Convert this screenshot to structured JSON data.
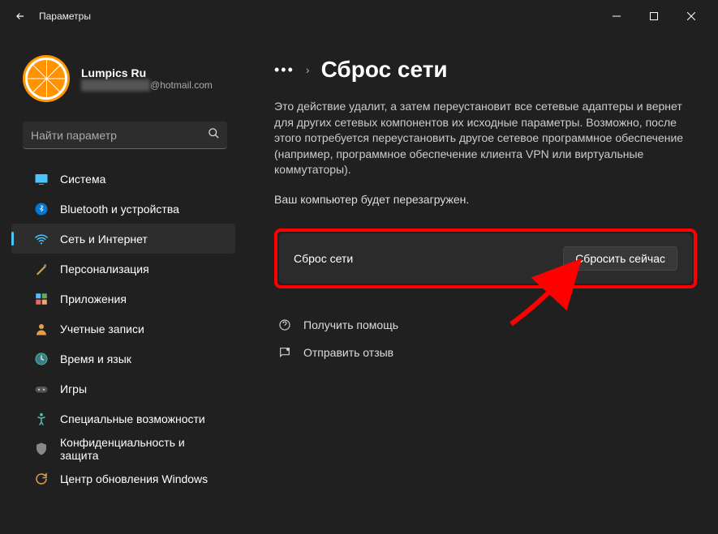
{
  "window": {
    "title": "Параметры"
  },
  "profile": {
    "name": "Lumpics Ru",
    "email_suffix": "@hotmail.com"
  },
  "search": {
    "placeholder": "Найти параметр"
  },
  "sidebar": {
    "items": [
      {
        "label": "Система",
        "icon": "system"
      },
      {
        "label": "Bluetooth и устройства",
        "icon": "bluetooth"
      },
      {
        "label": "Сеть и Интернет",
        "icon": "network"
      },
      {
        "label": "Персонализация",
        "icon": "personalize"
      },
      {
        "label": "Приложения",
        "icon": "apps"
      },
      {
        "label": "Учетные записи",
        "icon": "accounts"
      },
      {
        "label": "Время и язык",
        "icon": "time"
      },
      {
        "label": "Игры",
        "icon": "games"
      },
      {
        "label": "Специальные возможности",
        "icon": "accessibility"
      },
      {
        "label": "Конфиденциальность и защита",
        "icon": "privacy"
      },
      {
        "label": "Центр обновления Windows",
        "icon": "update"
      }
    ]
  },
  "main": {
    "breadcrumb_title": "Сброс сети",
    "description": "Это действие удалит, а затем переустановит все сетевые адаптеры и вернет для других сетевых компонентов их исходные параметры. Возможно, после этого потребуется переустановить другое сетевое программное обеспечение (например, программное обеспечение клиента VPN или виртуальные коммутаторы).",
    "restart_note": "Ваш компьютер будет перезагружен.",
    "reset_label": "Сброс сети",
    "reset_button": "Сбросить сейчас",
    "help_link": "Получить помощь",
    "feedback_link": "Отправить отзыв"
  }
}
